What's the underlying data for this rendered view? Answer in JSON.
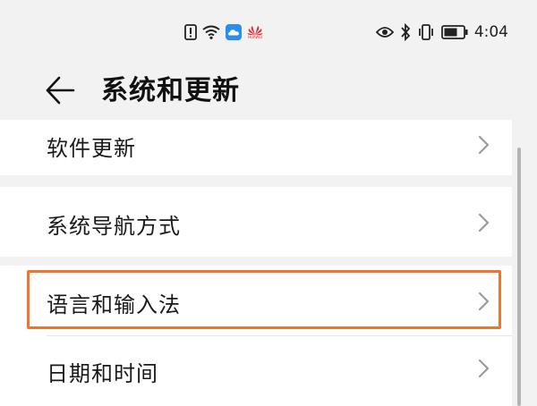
{
  "status_bar": {
    "time": "4:04",
    "left_icons": [
      "alert-icon",
      "wifi-icon",
      "cloud-icon",
      "huawei-logo"
    ],
    "right_icons": [
      "eye-comfort-icon",
      "bluetooth-icon",
      "vibrate-icon",
      "battery-icon"
    ],
    "huawei_text": "HUAWEI"
  },
  "header": {
    "title": "系统和更新",
    "back_icon": "back-arrow-icon"
  },
  "settings": {
    "items": [
      {
        "label": "软件更新"
      },
      {
        "label": "系统导航方式"
      },
      {
        "label": "语言和输入法",
        "highlighted": true
      },
      {
        "label": "日期和时间"
      }
    ]
  },
  "colors": {
    "background": "#f2f2f2",
    "card": "#ffffff",
    "highlight": "#ec7532",
    "cloud_blue": "#2a8df0",
    "huawei_red": "#e8282d"
  }
}
